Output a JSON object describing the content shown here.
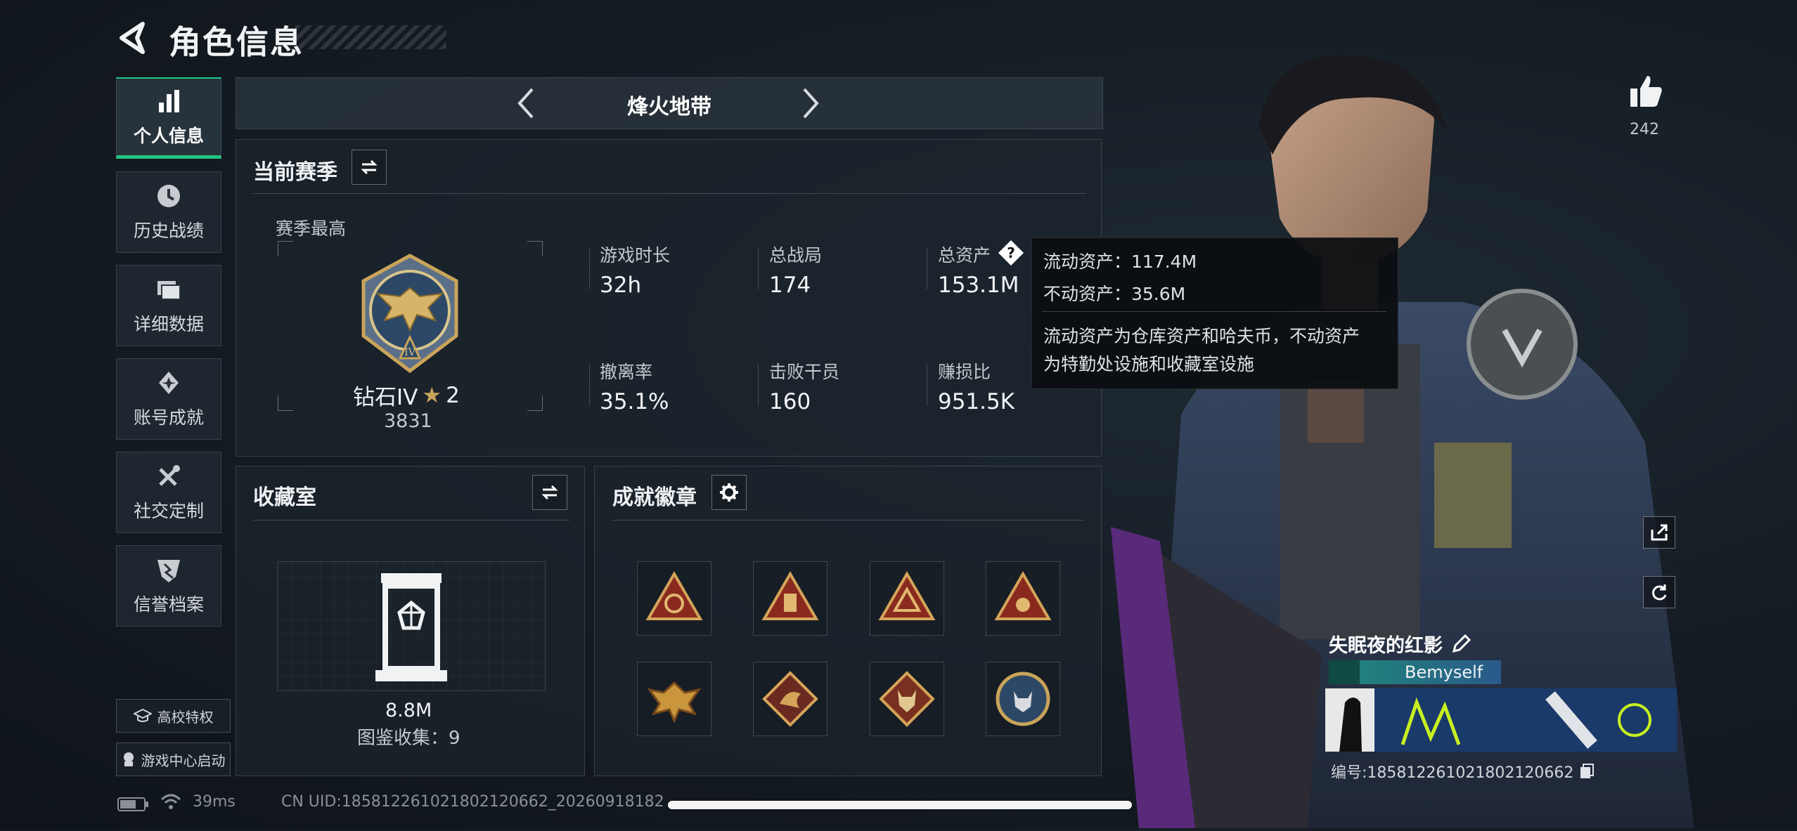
{
  "header": {
    "title": "角色信息"
  },
  "sidebar": {
    "items": [
      {
        "label": "个人信息",
        "icon": "bar-chart-icon",
        "active": true
      },
      {
        "label": "历史战绩",
        "icon": "clock-icon"
      },
      {
        "label": "详细数据",
        "icon": "folder-icon"
      },
      {
        "label": "账号成就",
        "icon": "achievement-icon"
      },
      {
        "label": "社交定制",
        "icon": "tools-icon"
      },
      {
        "label": "信誉档案",
        "icon": "shield-icon"
      }
    ],
    "campus_label": "高校特权",
    "game_center_label": "游戏中心启动"
  },
  "mode_bar": {
    "label": "烽火地带"
  },
  "season": {
    "title": "当前赛季",
    "best_label": "赛季最高",
    "rank_name": "钻石IV",
    "rank_stars": "2",
    "rank_points": "3831",
    "stats": [
      {
        "label": "游戏时长",
        "value": "32h"
      },
      {
        "label": "总战局",
        "value": "174"
      },
      {
        "label": "总资产",
        "value": "153.1M"
      },
      {
        "label": "撤离率",
        "value": "35.1%"
      },
      {
        "label": "击败干员",
        "value": "160"
      },
      {
        "label": "赚损比",
        "value": "951.5K"
      }
    ]
  },
  "tooltip": {
    "liquid": "流动资产：117.4M",
    "fixed": "不动资产：35.6M",
    "desc_line1": "流动资产为仓库资产和哈夫币，不动资产",
    "desc_line2": "为特勤处设施和收藏室设施"
  },
  "collection": {
    "title": "收藏室",
    "value": "8.8M",
    "count_label": "图鉴收集：9"
  },
  "achievements": {
    "title": "成就徽章"
  },
  "likes": {
    "count": "242"
  },
  "player": {
    "name": "失眠夜的红影",
    "tag": "Bemyself",
    "id_label": "编号:1858122610218021206​62"
  },
  "status_bar": {
    "ping": "39ms",
    "uid": "CN UID:185812261021802120662_20260918182"
  },
  "colors": {
    "accent": "#22c483",
    "gold": "#c9a45a"
  }
}
